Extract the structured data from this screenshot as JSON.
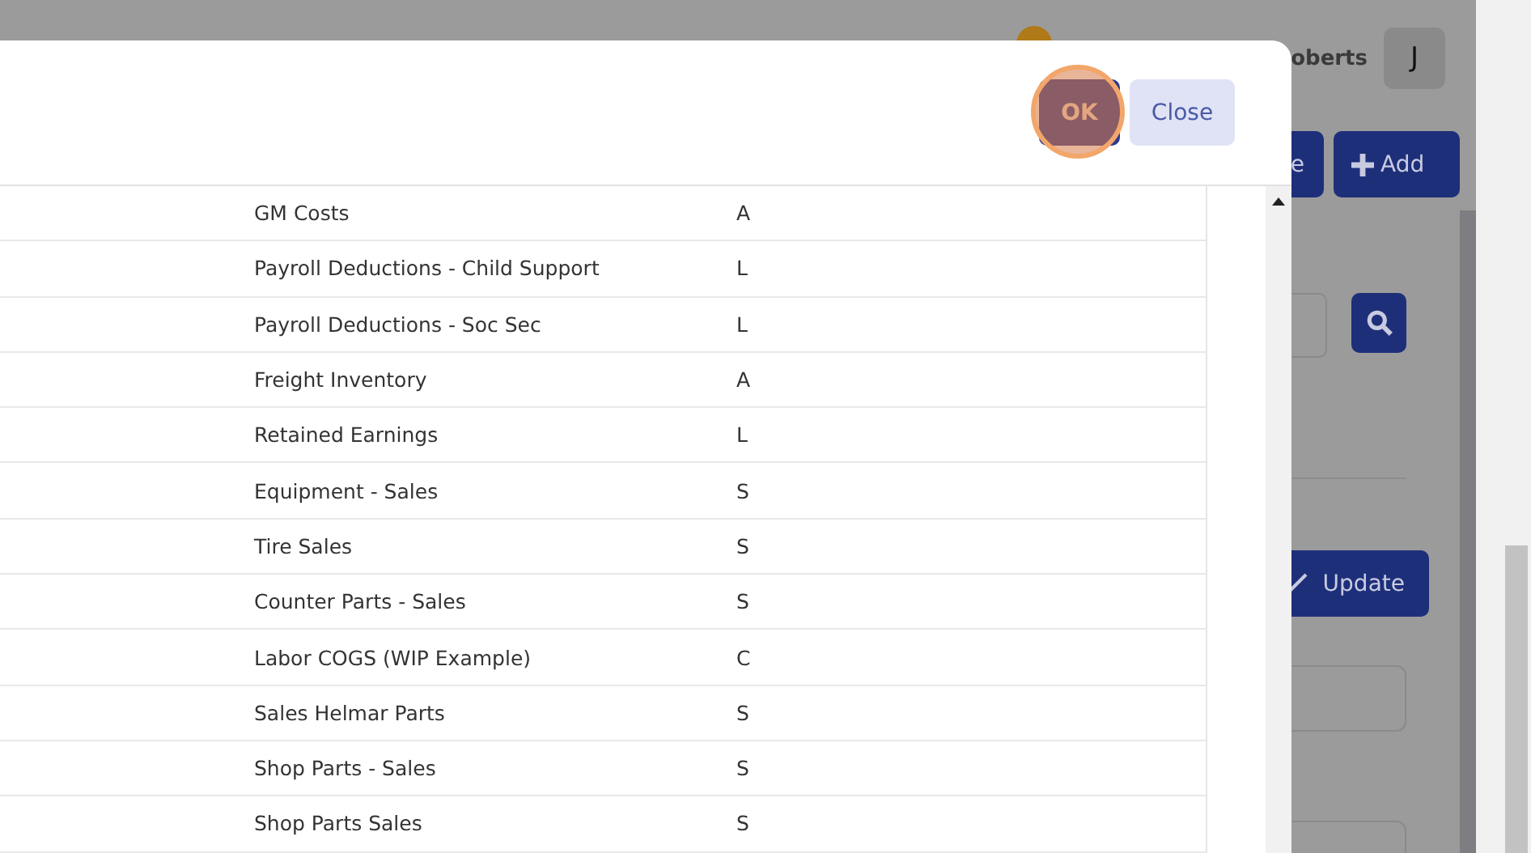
{
  "background_page": {
    "user_name": "oberts",
    "avatar_initial": "J",
    "toolbar_buttons": [
      {
        "label": "e",
        "kind": "plain"
      },
      {
        "label": "Add",
        "kind": "add"
      }
    ],
    "update_button": "Update"
  },
  "dialog": {
    "buttons": [
      {
        "label": "OK",
        "kind": "primary",
        "highlighted": true
      },
      {
        "label": "Close",
        "kind": "secondary",
        "highlighted": false
      }
    ],
    "rows": [
      {
        "name": "GM Costs",
        "type": "A"
      },
      {
        "name": "Payroll Deductions - Child Support",
        "type": "L"
      },
      {
        "name": "Payroll Deductions - Soc Sec",
        "type": "L"
      },
      {
        "name": "Freight Inventory",
        "type": "A"
      },
      {
        "name": "Retained Earnings",
        "type": "L"
      },
      {
        "name": "Equipment - Sales",
        "type": "S"
      },
      {
        "name": "Tire Sales",
        "type": "S"
      },
      {
        "name": "Counter Parts - Sales",
        "type": "S"
      },
      {
        "name": "Labor COGS (WIP Example)",
        "type": "C"
      },
      {
        "name": "Sales Helmar Parts",
        "type": "S"
      },
      {
        "name": "Shop Parts - Sales",
        "type": "S"
      },
      {
        "name": "Shop Parts Sales",
        "type": "S"
      }
    ]
  }
}
